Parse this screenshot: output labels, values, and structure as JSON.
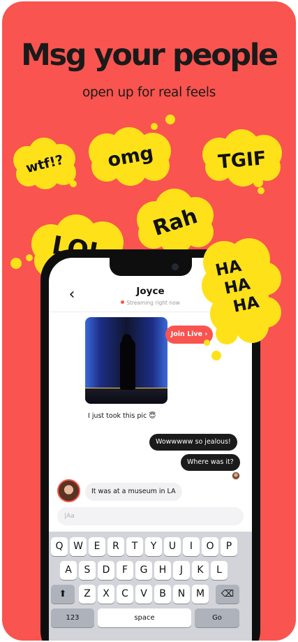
{
  "headline": "Msg your people",
  "subheadline": "open up for real feels",
  "bubbles": {
    "wtf": "wtf!?",
    "omg": "omg",
    "tgif": "TGIF",
    "rah": "Rah",
    "lol": "LOL",
    "ha1": "HA",
    "ha2": "HA",
    "ha3": "HA"
  },
  "chat": {
    "back_icon": "‹",
    "contact_name": "Joyce",
    "contact_status": "Streaming right now",
    "join_live_label": "Join Live ›",
    "messages": [
      {
        "from": "them",
        "text": "I just took this pic 😇"
      },
      {
        "from": "me",
        "text": "Wowwwww so jealous!"
      },
      {
        "from": "me",
        "text": "Where was it?"
      },
      {
        "from": "them",
        "text": "It was at a museum in LA"
      }
    ],
    "composer_placeholder": "|Aa"
  },
  "keyboard": {
    "row1": [
      "Q",
      "W",
      "E",
      "R",
      "T",
      "Y",
      "U",
      "I",
      "O",
      "P"
    ],
    "row2": [
      "A",
      "S",
      "D",
      "F",
      "G",
      "H",
      "J",
      "K",
      "L"
    ],
    "row3": [
      "Z",
      "X",
      "C",
      "V",
      "B",
      "N",
      "M"
    ],
    "shift_icon": "⬆",
    "delete_icon": "⌫",
    "numbers_label": "123",
    "space_label": "space",
    "go_label": "Go"
  },
  "colors": {
    "background": "#F9544F",
    "bubble": "#FFE11A",
    "accent": "#F9544F"
  }
}
